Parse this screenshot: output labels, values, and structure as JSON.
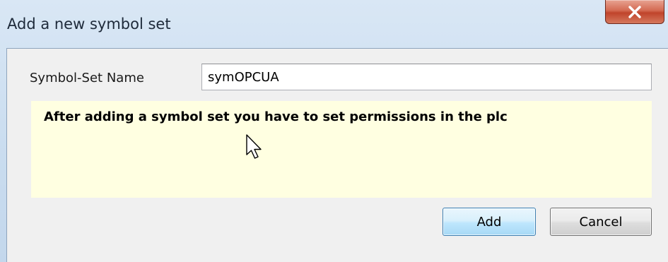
{
  "window": {
    "title": "Add a new symbol set"
  },
  "form": {
    "name_label": "Symbol-Set Name",
    "name_value": "symOPCUA"
  },
  "info": {
    "message": "After adding a symbol set you have to set permissions in the plc"
  },
  "buttons": {
    "add_label": "Add",
    "cancel_label": "Cancel"
  },
  "icons": {
    "close": "close-icon",
    "cursor": "mouse-pointer-icon"
  },
  "colors": {
    "info_background": "#ffffe1",
    "close_button": "#c0442b",
    "default_button_border": "#3c7fb1"
  }
}
